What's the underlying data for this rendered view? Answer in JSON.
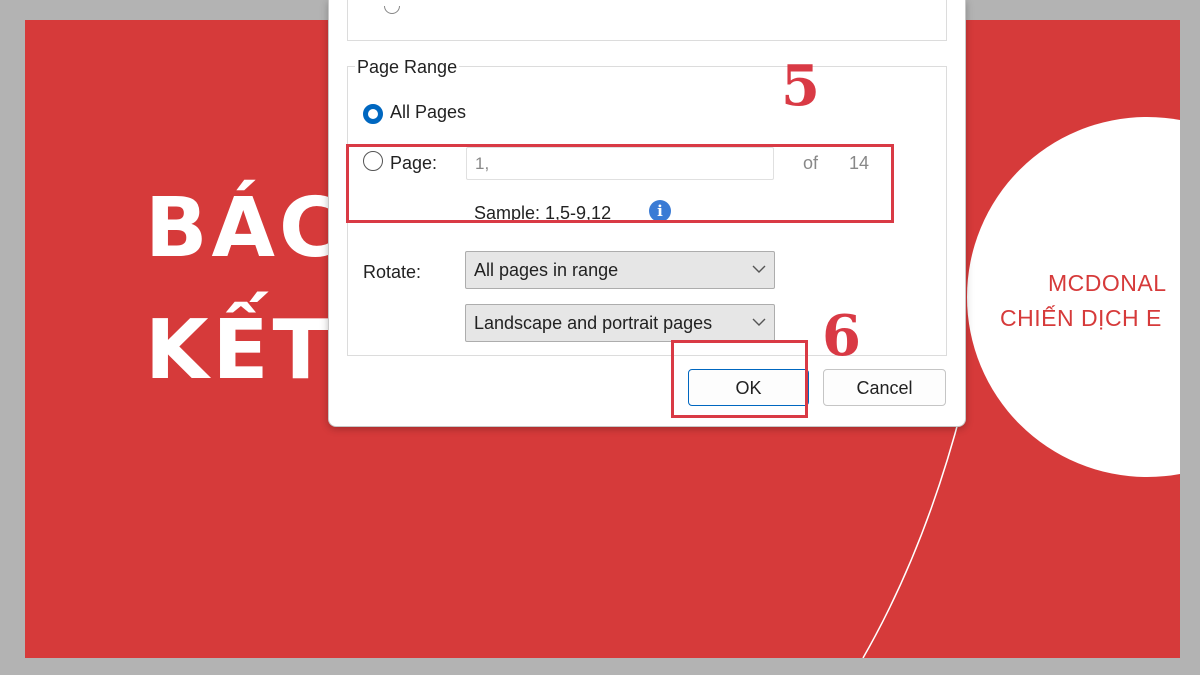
{
  "slide": {
    "title_line1": "BÁC",
    "title_line2": "KẾT",
    "circle_line1": "MCDONAL",
    "circle_line2": "CHIẾN DỊCH E"
  },
  "dialog": {
    "page_range": {
      "legend": "Page Range",
      "all_pages_label": "All Pages",
      "page_label": "Page:",
      "page_input_value": "1,",
      "of_label": "of",
      "total_pages": "14",
      "sample_text": "Sample: 1,5-9,12",
      "info_icon_glyph": "i"
    },
    "rotate": {
      "label": "Rotate:",
      "range_select_value": "All pages in range",
      "orientation_select_value": "Landscape and portrait pages"
    },
    "buttons": {
      "ok": "OK",
      "cancel": "Cancel"
    }
  },
  "annotations": {
    "step5": "5",
    "step6": "6"
  },
  "colors": {
    "slide_red": "#d63a3a",
    "annotation_red": "#d93a45",
    "accent_blue": "#0067c0"
  }
}
